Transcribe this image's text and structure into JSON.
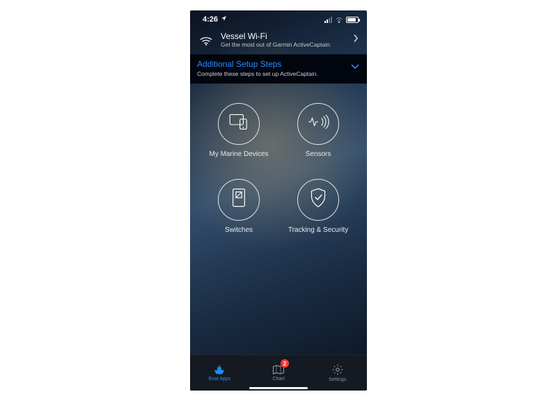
{
  "status": {
    "time": "4:26"
  },
  "vesselWifi": {
    "title": "Vessel Wi-Fi",
    "subtitle": "Get the most out of Garmin ActiveCaptain."
  },
  "setup": {
    "title": "Additional Setup Steps",
    "subtitle": "Complete these steps to set up ActiveCaptain."
  },
  "features": {
    "marineDevices": "My Marine Devices",
    "sensors": "Sensors",
    "switches": "Switches",
    "tracking": "Tracking & Security"
  },
  "tabs": {
    "boatApps": "Boat Apps",
    "chart": "Chart",
    "chartBadge": "2",
    "settings": "Settings"
  }
}
